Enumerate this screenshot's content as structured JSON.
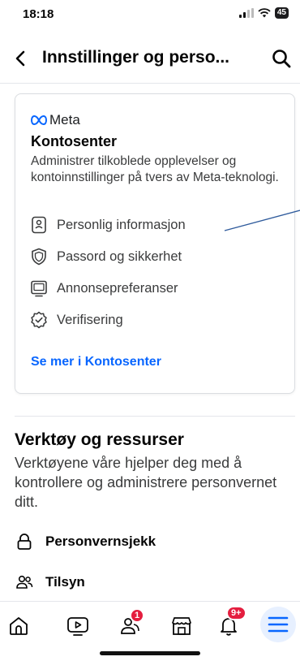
{
  "status_bar": {
    "time": "18:18",
    "battery": "45"
  },
  "header": {
    "title": "Innstillinger og perso..."
  },
  "card": {
    "brand": "Meta",
    "title": "Kontosenter",
    "description": "Administrer tilkoblede opplevelser og kontoinnstillinger på tvers av Meta-teknologi.",
    "items": [
      {
        "label": "Personlig informasjon",
        "icon": "id-card-icon"
      },
      {
        "label": "Passord og sikkerhet",
        "icon": "shield-icon"
      },
      {
        "label": "Annonsepreferanser",
        "icon": "monitor-icon"
      },
      {
        "label": "Verifisering",
        "icon": "verified-badge-icon"
      }
    ],
    "see_more": "Se mer i Kontosenter"
  },
  "tools": {
    "title": "Verktøy og ressurser",
    "description": "Verktøyene våre hjelper deg med å kontrollere og administrere personvernet ditt.",
    "items": [
      {
        "label": "Personvernsjekk",
        "icon": "lock-icon"
      },
      {
        "label": "Tilsyn",
        "icon": "people-icon"
      }
    ]
  },
  "tabbar": {
    "tabs": [
      "home-icon",
      "video-icon",
      "friends-icon",
      "marketplace-icon",
      "notifications-icon",
      "menu-icon"
    ],
    "friends_badge": "1",
    "notifications_badge": "9+"
  },
  "colors": {
    "accent": "#0866ff",
    "badge": "#e41e3f",
    "annotation": "#2f5b9c"
  }
}
